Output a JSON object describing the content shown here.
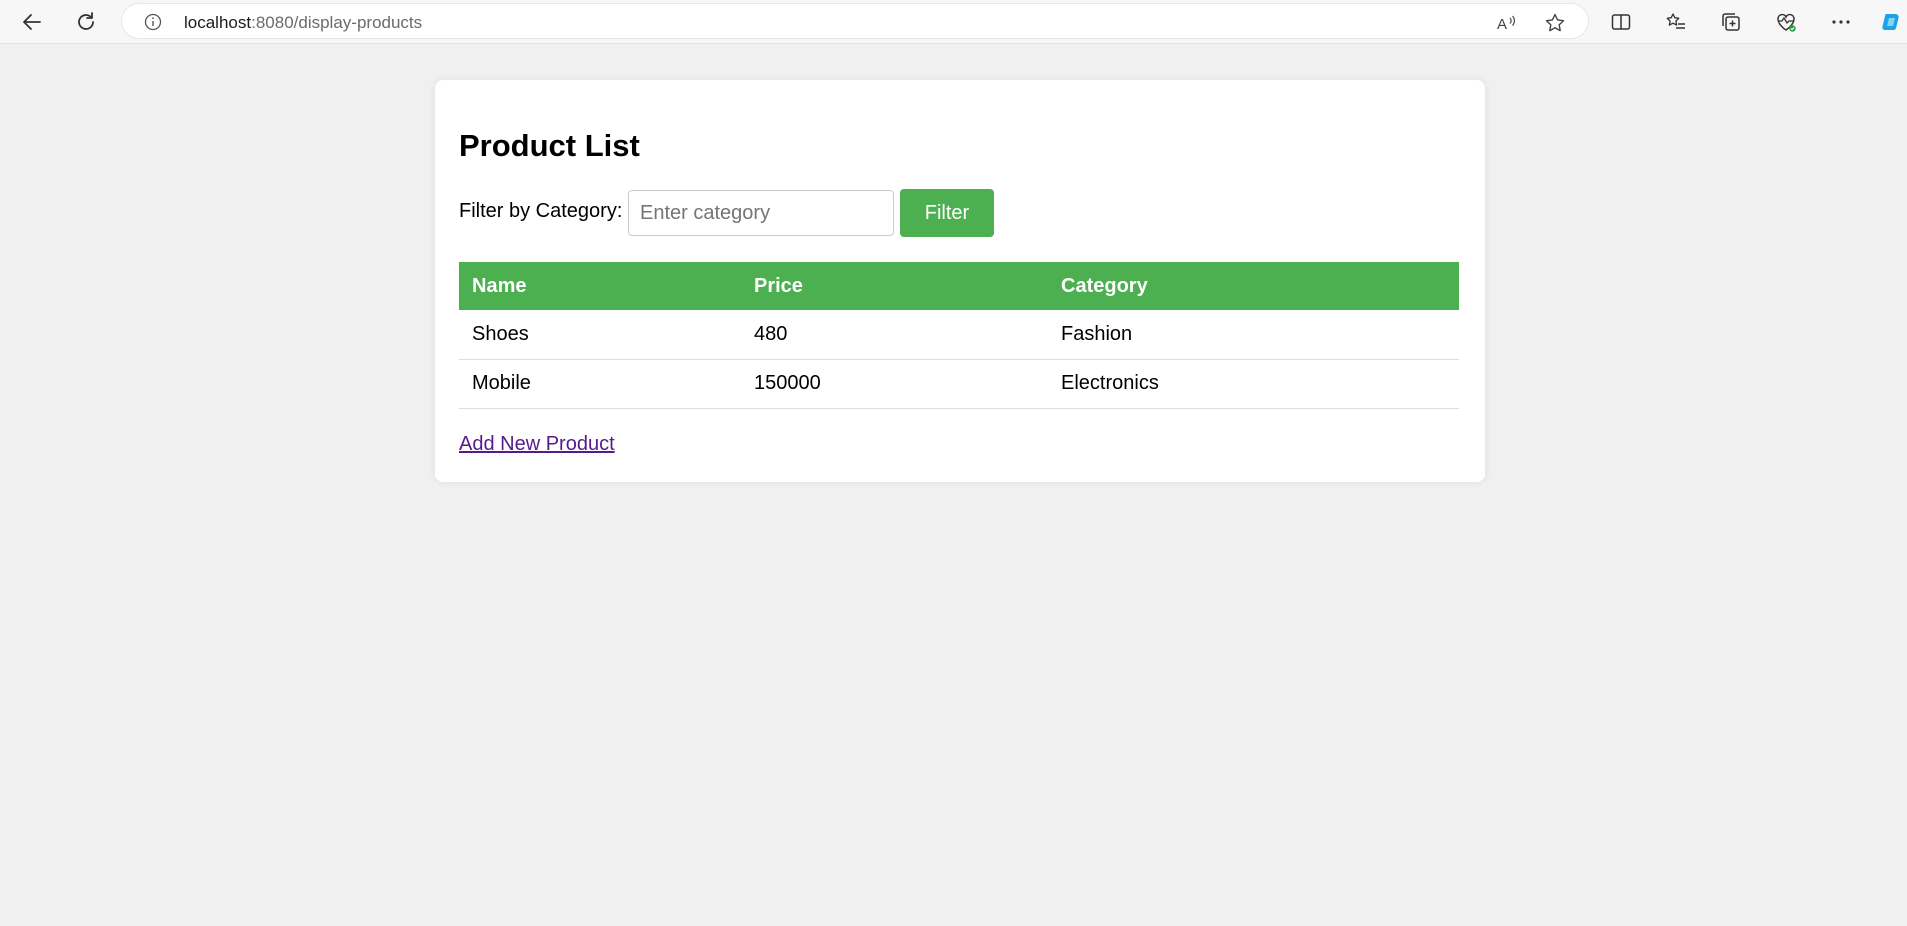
{
  "browser": {
    "url_host": "localhost",
    "url_path": ":8080/display-products",
    "icons": {
      "back": "back-arrow-icon",
      "reload": "reload-icon",
      "info": "info-icon",
      "read_aloud": "read-aloud-icon",
      "favorite": "star-icon",
      "split_screen": "split-screen-icon",
      "favorites": "favorites-list-icon",
      "collections": "collections-icon",
      "browser_essentials": "heart-pulse-icon",
      "more": "more-dots-icon",
      "copilot": "copilot-icon"
    }
  },
  "page": {
    "title": "Product List",
    "filter": {
      "label": "Filter by Category:",
      "placeholder": "Enter category",
      "value": "",
      "button_label": "Filter"
    },
    "table": {
      "headers": [
        "Name",
        "Price",
        "Category"
      ],
      "rows": [
        [
          "Shoes",
          "480",
          "Fashion"
        ],
        [
          "Mobile",
          "150000",
          "Electronics"
        ]
      ]
    },
    "add_link_label": "Add New Product"
  },
  "colors": {
    "accent": "#4caf50",
    "page_background": "#f0f0f0",
    "link_visited": "#551a8b"
  }
}
